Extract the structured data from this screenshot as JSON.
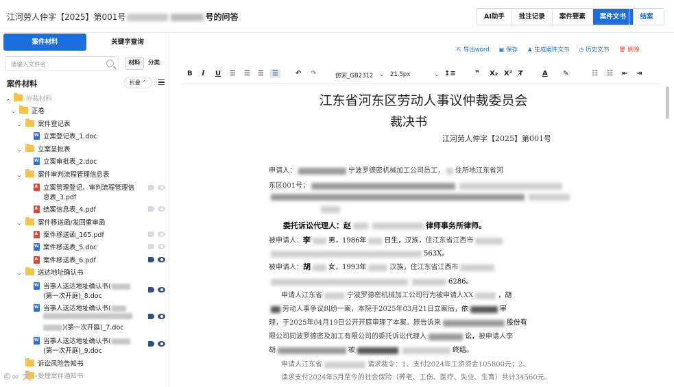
{
  "header": {
    "title_prefix": "江河劳人仲字【2025】第001号",
    "title_suffix": "号的问答",
    "buttons": [
      "AI助手",
      "批注记录",
      "案件要素",
      "案件文书"
    ],
    "active_button": "案件文书",
    "close_label": "结案"
  },
  "sidebar": {
    "tab_materials": "案件材料",
    "tab_keyword": "关键字查询",
    "search_placeholder": "请输入文件名",
    "seg_material": "材料",
    "seg_category": "分类",
    "heading": "案件材料",
    "fold_label": "折叠 ⌃",
    "tree": [
      {
        "label": "仲裁材料",
        "type": "folder",
        "faded": true
      },
      {
        "label": "正卷",
        "type": "folder"
      },
      {
        "label": "案件登记表",
        "type": "folder"
      },
      {
        "label": "立案登记表_1.doc",
        "type": "doc"
      },
      {
        "label": "立案呈批表",
        "type": "folder"
      },
      {
        "label": "立案审批表_2.doc",
        "type": "doc"
      },
      {
        "label": "案件审判流程管理信息表",
        "type": "folder"
      },
      {
        "label": "立案管理登记、审判流程管理信",
        "type": "pdf"
      },
      {
        "label": "息表_3.pdf",
        "type": "text"
      },
      {
        "label": "结案信息表_4.pdf",
        "type": "pdf"
      },
      {
        "label": "案件移送函/发回重审函",
        "type": "folder"
      },
      {
        "label": "案件移送函_165.pdf",
        "type": "pdf"
      },
      {
        "label": "案件移送表_5.doc",
        "type": "doc"
      },
      {
        "label": "案件移送表_6.pdf",
        "type": "pdf"
      },
      {
        "label": "送达地址确认书",
        "type": "folder"
      },
      {
        "label": "当事人送达地址确认书(",
        "type": "doc"
      },
      {
        "label": "(第一次开庭)_8.doc",
        "type": "text"
      },
      {
        "label": "当事人送达地址确认书(",
        "type": "doc"
      },
      {
        "label": ")(第一次开庭)_7.doc",
        "type": "text"
      },
      {
        "label": "当事人送达地址确认书(",
        "type": "doc"
      },
      {
        "label": "(第一次开庭)_9.doc",
        "type": "text"
      },
      {
        "label": "诉讼风险告知书",
        "type": "folder"
      },
      {
        "label": "受理案件通知书",
        "type": "folder",
        "faded": true
      }
    ]
  },
  "actions": {
    "export_word": "导出word",
    "save": "保存",
    "generate": "生成案件文书",
    "history": "历史文书",
    "delete": "删除"
  },
  "toolbar": {
    "font": "仿宋_GB2312",
    "size": "21.5px"
  },
  "document": {
    "title": "江东省河东区劳动人事议仲裁委员会",
    "subtitle": "裁决书",
    "case_number": "江河劳人仲字【2025】第001号",
    "p1": "申请人：",
    "p1b": "宁波罗德密机械加工公司员工，",
    "p1c": "住所地江东省河",
    "p2": "东区001号；",
    "p5": "委托诉讼代理人：赵",
    "p5b": "律师事务所律师。",
    "p6": "被申请人：",
    "p6b": "李",
    "p6c": "男，1986年",
    "p6d": "日生，",
    "p6e": "汉族，住江东省江西市",
    "p7": "563X。",
    "p8": "被申请人：",
    "p8b": "胡",
    "p8c": "女，1993年",
    "p8d": "汉族，住江东省江西市",
    "p9": "6286。",
    "p10": "申请人江东省",
    "p10b": "宁波罗德密机械加工公司行为被申请人XX",
    "p10c": "，胡",
    "p11": "劳动人事争议纠纷一案，本院于2025年03月21日立案后，",
    "p11b": "依",
    "p11c": "审",
    "p12": "理，于2025年04月19日公开开庭审理了本案。",
    "p12b": "原告诉来",
    "p12c": "股份有",
    "p13": "限公司同波罗德密及加工有限公司的委托诉讼代理人",
    "p13b": "讼，",
    "p13c": "被申请人李",
    "p14": "胡",
    "p14b": "被",
    "p14c": "终结。",
    "p15": "申请人江东省",
    "p15b": "请求裁令：1、支付2024年工资资金105800元；2、",
    "p16": "请求支付2024年5月至今的社会保险（养老、工伤、医疗、失业、生育）共计34560元。"
  }
}
